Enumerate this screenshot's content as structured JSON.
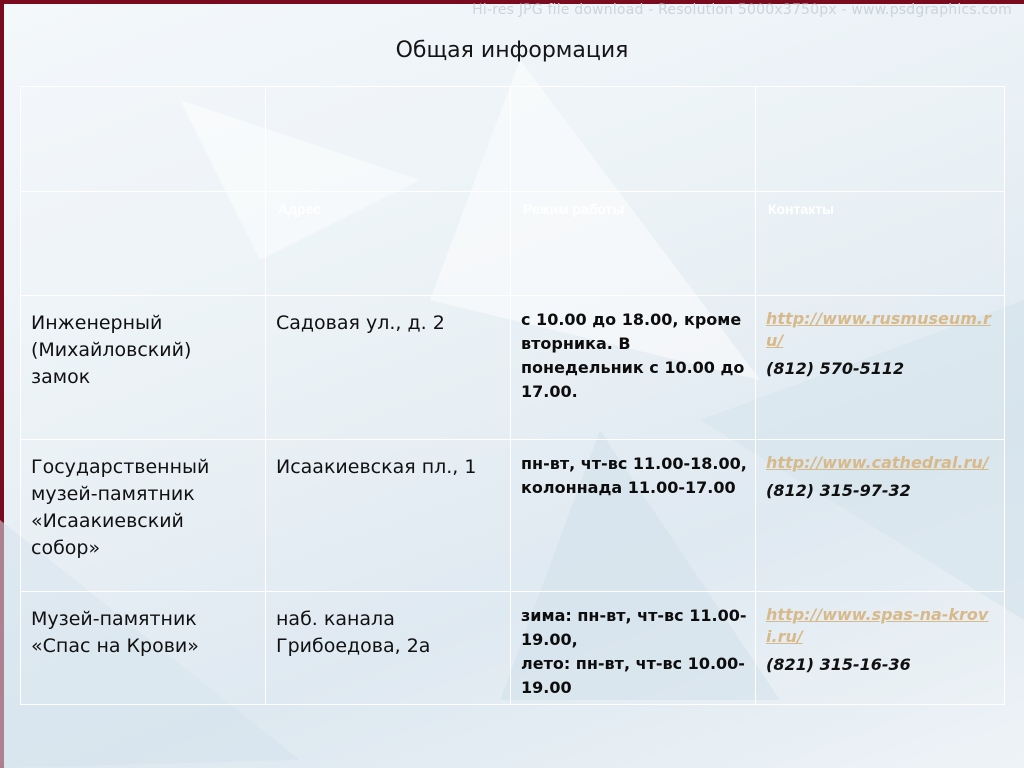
{
  "watermark": "Hi-res JPG file download  -  Resolution 5000x3750px  -  www.psdgraphics.com",
  "title": "Общая информация",
  "table": {
    "header": {
      "address": "Адрес",
      "hours": "Режим работы",
      "contacts": "Контакты"
    },
    "rows": [
      {
        "name": "Инженерный (Михайловский) замок",
        "address": "Садовая ул., д. 2",
        "hours": " с 10.00 до 18.00, кроме вторника. В понедельник с 10.00 до 17.00.",
        "link": "http://www.rusmuseum.ru/",
        "phone": "(812) 570-5112"
      },
      {
        "name": "Государственный музей-памятник «Исаакиевский собор»",
        "address": "Исаакиевская пл., 1",
        "hours": "пн-вт, чт-вс 11.00-18.00, колоннада 11.00-17.00",
        "link": "http://www.cathedral.ru/",
        "phone": "(812) 315-97-32"
      },
      {
        "name": "Музей-памятник «Спас на Крови»",
        "address": "наб. канала Грибоедова, 2а",
        "hours": "зима: пн-вт, чт-вс 11.00-19.00,\n лето: пн-вт, чт-вс 10.00-19.00",
        "link": "http://www.spas-na-krovi.ru/",
        "phone": "(821) 315-16-36"
      }
    ]
  },
  "colors": {
    "frame": "#7a0a1e",
    "link": "#d8b98a",
    "header_text": "#ffffff"
  }
}
